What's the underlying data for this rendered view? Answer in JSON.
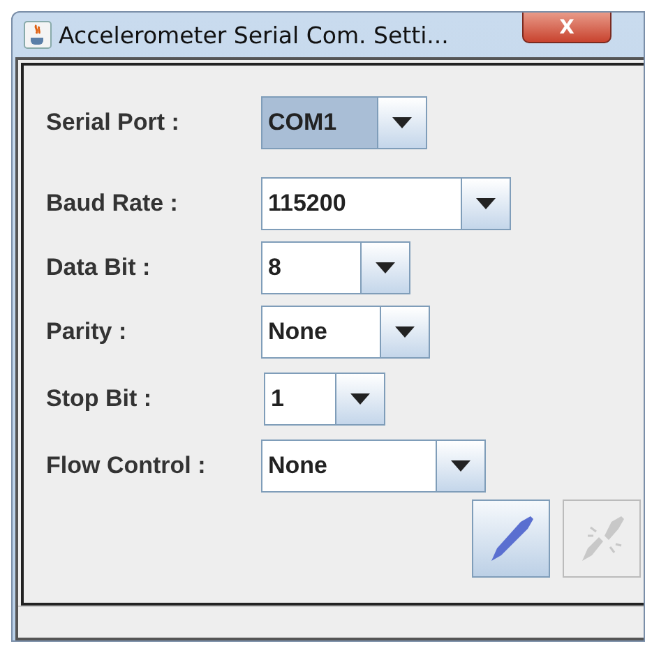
{
  "window": {
    "title": "Accelerometer Serial Com. Setti...",
    "close": "X"
  },
  "settings": [
    {
      "label": "Serial Port :",
      "value": "COM1",
      "focused": true
    },
    {
      "label": "Baud Rate :",
      "value": "115200",
      "focused": false
    },
    {
      "label": "Data Bit :",
      "value": "8",
      "focused": false
    },
    {
      "label": "Parity :",
      "value": "None",
      "focused": false
    },
    {
      "label": "Stop Bit :",
      "value": "1",
      "focused": false
    },
    {
      "label": "Flow Control :",
      "value": "None",
      "focused": false
    }
  ],
  "buttons": [
    {
      "kind": "connect",
      "disabled": false
    },
    {
      "kind": "disconnect",
      "disabled": true
    }
  ]
}
